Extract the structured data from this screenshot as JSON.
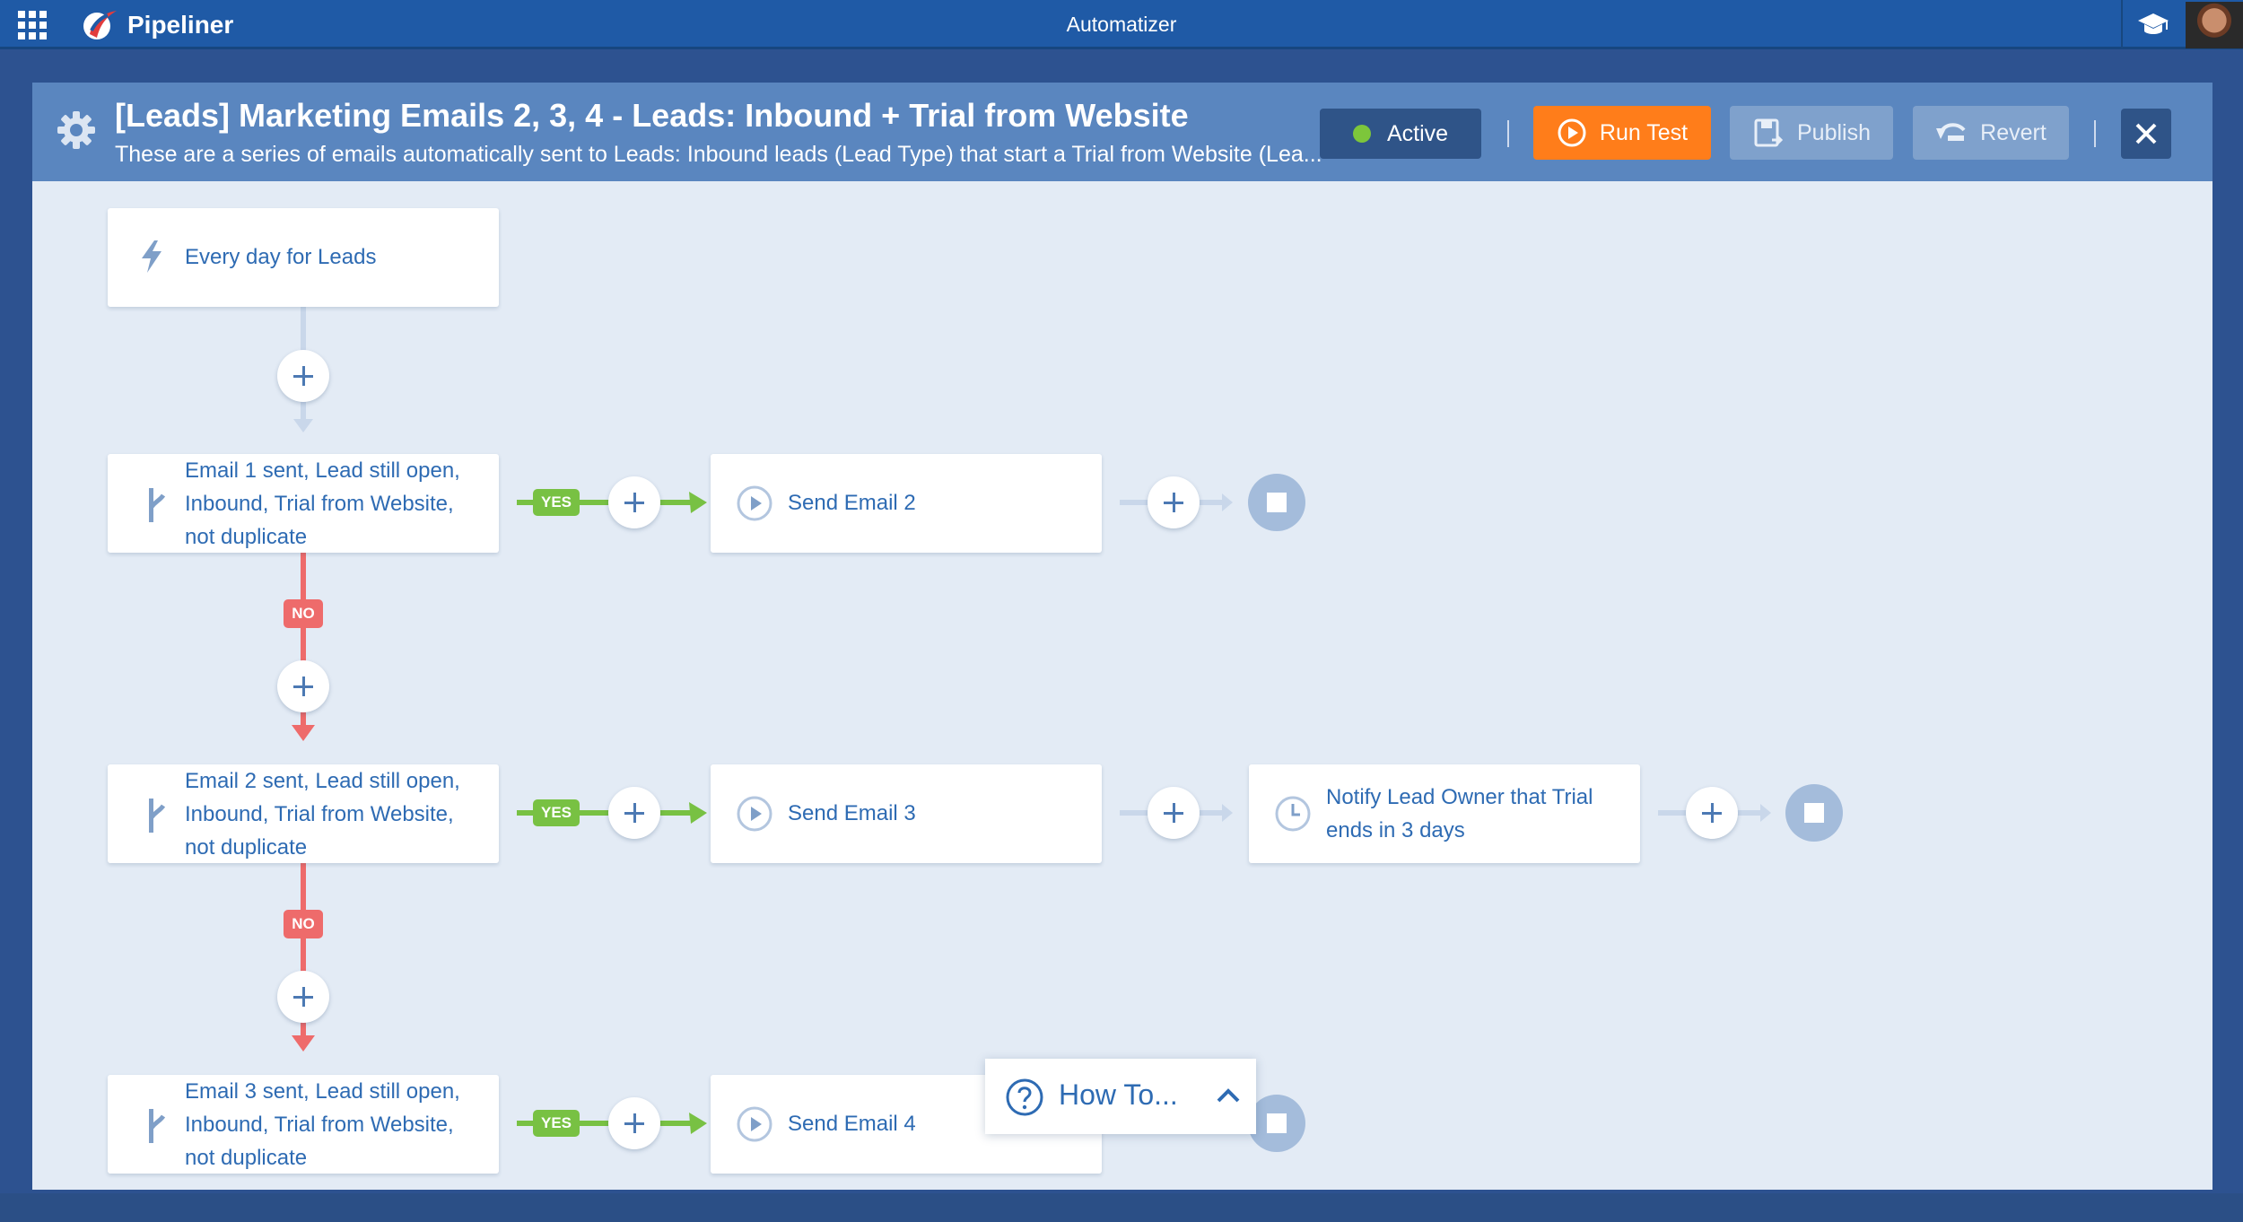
{
  "topbar": {
    "brand": "Pipeliner",
    "app_title": "Automatizer",
    "icons": [
      "apps-grid-icon",
      "pipeliner-logo",
      "academy-icon",
      "user-avatar"
    ]
  },
  "automation": {
    "title": "[Leads] Marketing Emails 2, 3, 4 - Leads: Inbound + Trial from Website",
    "description": "These are a series of emails automatically sent to Leads: Inbound leads (Lead Type) that start a Trial from Website (Lea...",
    "status": "Active",
    "run_test_label": "Run Test",
    "publish_label": "Publish",
    "revert_label": "Revert"
  },
  "flow": {
    "trigger": "Every day for Leads",
    "yes_label": "YES",
    "no_label": "NO",
    "conditions": [
      {
        "l1": "Email 1 sent, Lead still open,",
        "l2": "Inbound, Trial from Website,",
        "l3": "not duplicate"
      },
      {
        "l1": "Email 2 sent, Lead still open,",
        "l2": "Inbound, Trial from Website,",
        "l3": "not duplicate"
      },
      {
        "l1": "Email 3 sent, Lead still open,",
        "l2": "Inbound, Trial from Website,",
        "l3": "not duplicate"
      }
    ],
    "actions": [
      "Send Email 2",
      "Send Email 3",
      "Send Email 4"
    ],
    "notify": {
      "l1": "Notify Lead Owner that Trial",
      "l2": "ends in 3 days"
    }
  },
  "howto": {
    "label": "How To..."
  },
  "colors": {
    "topbar": "#1f5aa6",
    "header": "#5a86bf",
    "canvas": "#e3ebf5",
    "run_test": "#ff7d1a",
    "active_dot": "#7dc63b",
    "yes": "#78c143",
    "no": "#ee6b6b",
    "node_text": "#2e6bb3"
  }
}
